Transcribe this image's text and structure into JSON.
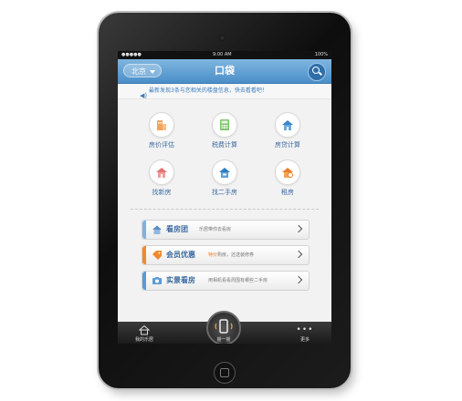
{
  "status": {
    "carrier": "●●●●●",
    "time": "9:00 AM",
    "battery": "100%"
  },
  "header": {
    "city": "北京",
    "title": "口袋"
  },
  "notice": {
    "text": "最新发现3条与您相关的楼盘信息，快去看看吧！"
  },
  "tools": [
    {
      "label": "房价评估",
      "icon": "building-icon"
    },
    {
      "label": "税费计算",
      "icon": "calculator-icon"
    },
    {
      "label": "房贷计算",
      "icon": "house-loan-icon"
    },
    {
      "label": "找新房",
      "icon": "new-house-icon"
    },
    {
      "label": "找二手房",
      "icon": "second-hand-house-icon"
    },
    {
      "label": "租房",
      "icon": "rent-house-icon"
    }
  ],
  "list": [
    {
      "title": "看房团",
      "subtitle_pre": "乐居带你去看房",
      "subtitle_hl": "",
      "subtitle_post": "",
      "color": "#7fb0e0"
    },
    {
      "title": "会员优惠",
      "subtitle_pre": "",
      "subtitle_hl": "特价",
      "subtitle_post": "购房，还送装修券",
      "color": "#f08a2c"
    },
    {
      "title": "实景看房",
      "subtitle_pre": "用相机看看周围有哪些二手房",
      "subtitle_hl": "",
      "subtitle_post": "",
      "color": "#5a9ad8"
    }
  ],
  "tabbar": {
    "home": "我的乐居",
    "shake": "摇一摇",
    "more": "更多"
  }
}
